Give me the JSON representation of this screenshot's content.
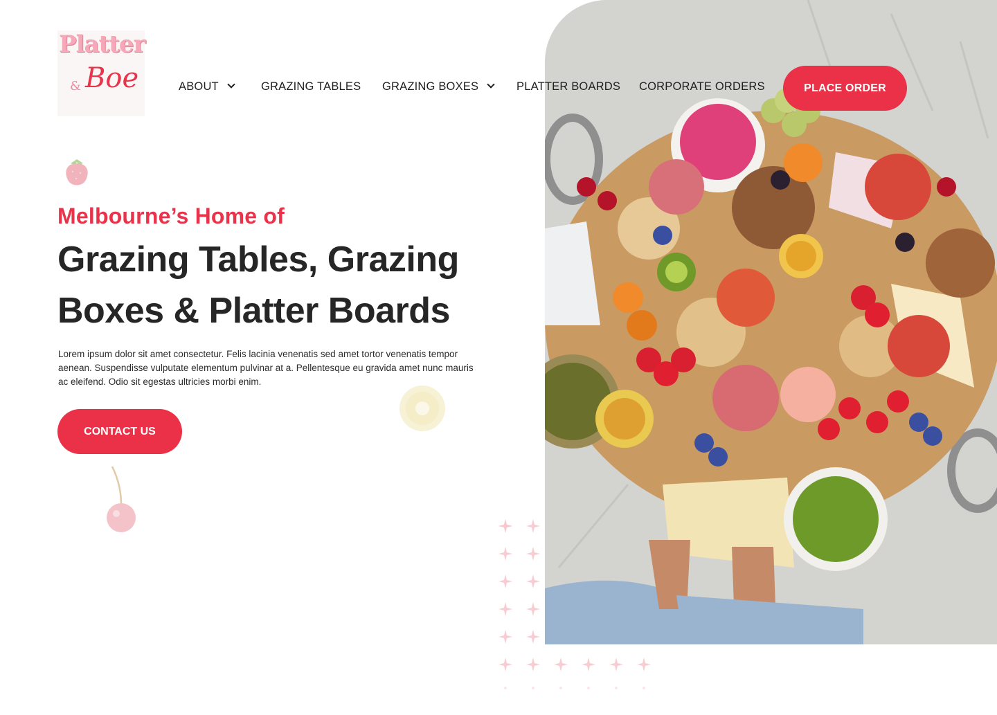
{
  "logo": {
    "top_text": "Platter",
    "amp": "&",
    "bottom_text": "Boe"
  },
  "nav": {
    "items": [
      {
        "label": "ABOUT",
        "has_dropdown": true
      },
      {
        "label": "GRAZING TABLES",
        "has_dropdown": false
      },
      {
        "label": "GRAZING BOXES",
        "has_dropdown": true
      },
      {
        "label": "PLATTER BOARDS",
        "has_dropdown": false
      },
      {
        "label": "CORPORATE ORDERS",
        "has_dropdown": false
      }
    ],
    "cta_label": "PLACE ORDER"
  },
  "hero": {
    "subheading": "Melbourne’s Home of",
    "headline_line1": "Grazing Tables, Grazing",
    "headline_line2": "Boxes & Platter Boards",
    "body": "Lorem ipsum dolor sit amet consectetur. Felis lacinia venenatis sed amet tortor venenatis tempor aenean. Suspendisse vulputate elementum pulvinar at a. Pellentesque eu gravida amet nunc mauris ac eleifend. Odio sit egestas ultricies morbi enim.",
    "cta_label": "CONTACT US"
  },
  "colors": {
    "accent": "#ea3147",
    "text": "#262626",
    "background": "#ffffff"
  },
  "decorations": [
    "strawberry-icon",
    "kiwi-slice-icon",
    "cherry-icon",
    "dot-pattern"
  ]
}
